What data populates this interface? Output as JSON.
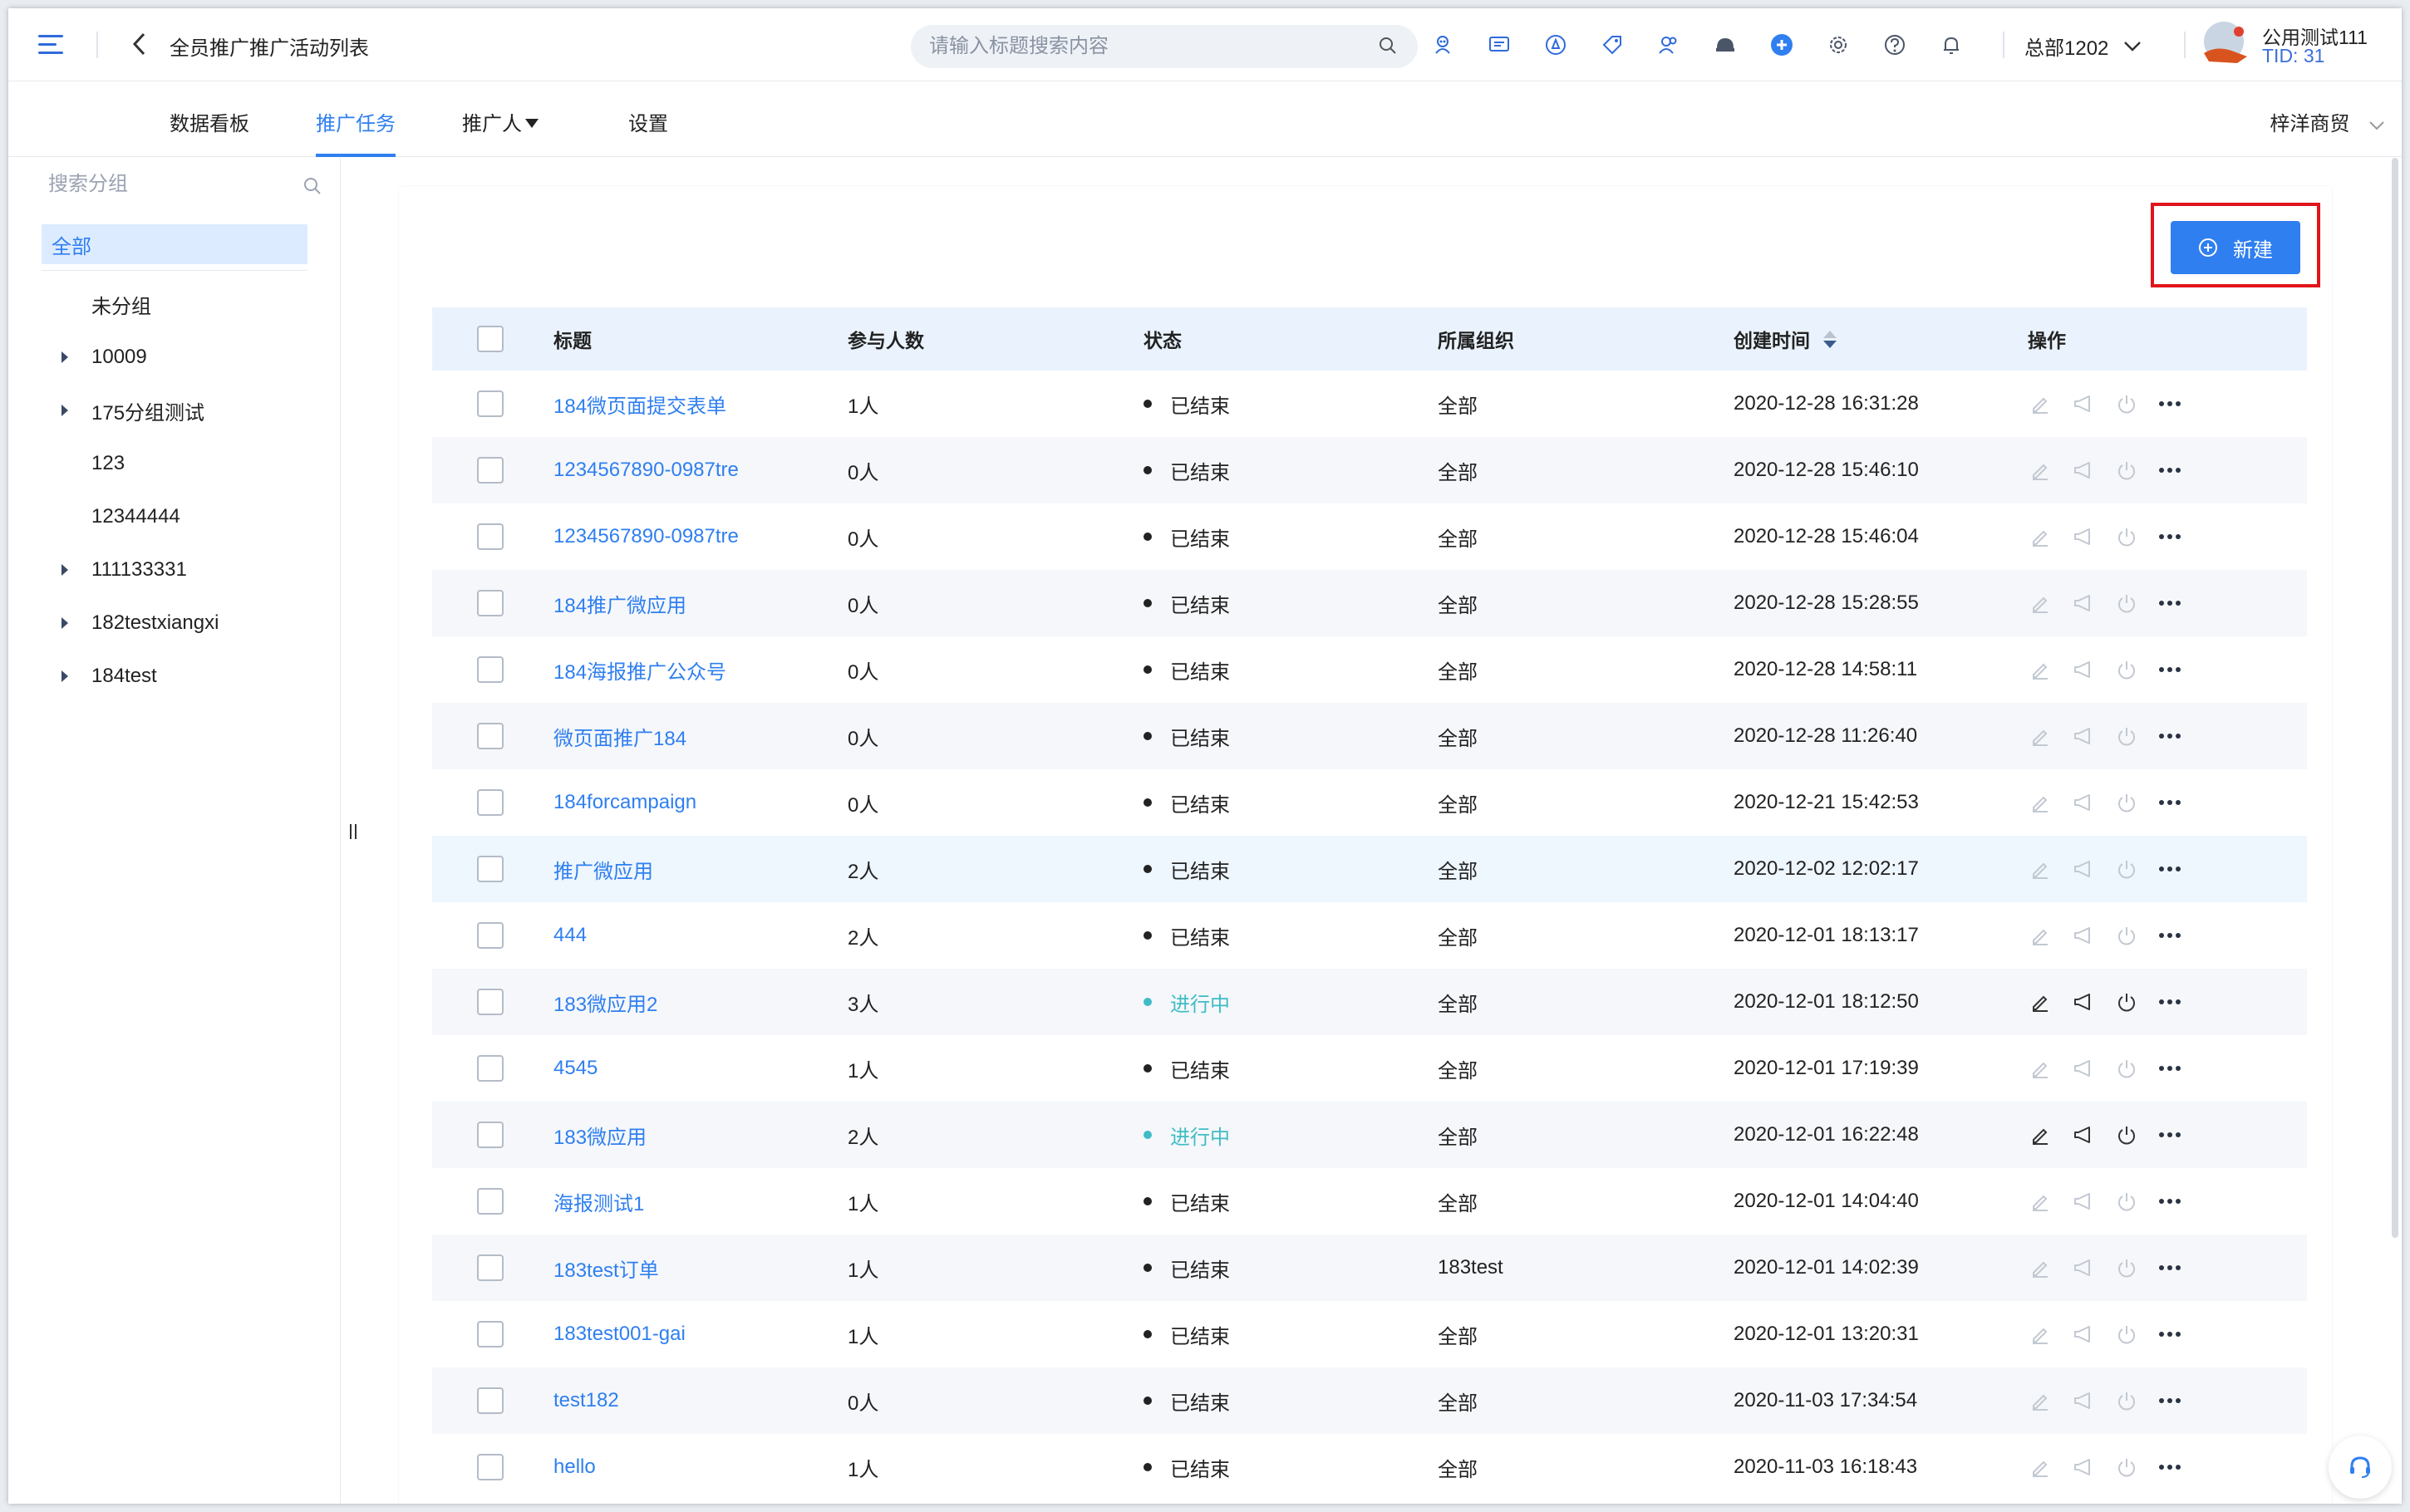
{
  "header": {
    "title": "全员推广推广活动列表",
    "search_placeholder": "请输入标题搜索内容",
    "org": "总部1202",
    "user_name": "公用测试111",
    "user_tid": "TID: 31"
  },
  "tabs": [
    {
      "label": "数据看板"
    },
    {
      "label": "推广任务"
    },
    {
      "label": "推广人"
    },
    {
      "label": "设置"
    }
  ],
  "tab_right": "梓洋商贸",
  "sidebar": {
    "search_placeholder": "搜索分组",
    "items": [
      {
        "label": "全部"
      },
      {
        "label": "未分组"
      },
      {
        "label": "10009"
      },
      {
        "label": "175分组测试"
      },
      {
        "label": "123"
      },
      {
        "label": "12344444"
      },
      {
        "label": "111133331"
      },
      {
        "label": "182testxiangxi"
      },
      {
        "label": "184test"
      }
    ]
  },
  "new_button": "新建",
  "table": {
    "columns": [
      "标题",
      "参与人数",
      "状态",
      "所属组织",
      "创建时间",
      "操作"
    ],
    "rows": [
      {
        "title": "184微页面提交表单",
        "count": "1人",
        "status": "已结束",
        "org": "全部",
        "time": "2020-12-28 16:31:28"
      },
      {
        "title": "1234567890-0987tre",
        "count": "0人",
        "status": "已结束",
        "org": "全部",
        "time": "2020-12-28 15:46:10"
      },
      {
        "title": "1234567890-0987tre",
        "count": "0人",
        "status": "已结束",
        "org": "全部",
        "time": "2020-12-28 15:46:04"
      },
      {
        "title": "184推广微应用",
        "count": "0人",
        "status": "已结束",
        "org": "全部",
        "time": "2020-12-28 15:28:55"
      },
      {
        "title": "184海报推广公众号",
        "count": "0人",
        "status": "已结束",
        "org": "全部",
        "time": "2020-12-28 14:58:11"
      },
      {
        "title": "微页面推广184",
        "count": "0人",
        "status": "已结束",
        "org": "全部",
        "time": "2020-12-28 11:26:40"
      },
      {
        "title": "184forcampaign",
        "count": "0人",
        "status": "已结束",
        "org": "全部",
        "time": "2020-12-21 15:42:53"
      },
      {
        "title": "推广微应用",
        "count": "2人",
        "status": "已结束",
        "org": "全部",
        "time": "2020-12-02 12:02:17"
      },
      {
        "title": "444",
        "count": "2人",
        "status": "已结束",
        "org": "全部",
        "time": "2020-12-01 18:13:17"
      },
      {
        "title": "183微应用2",
        "count": "3人",
        "status": "进行中",
        "org": "全部",
        "time": "2020-12-01 18:12:50"
      },
      {
        "title": "4545",
        "count": "1人",
        "status": "已结束",
        "org": "全部",
        "time": "2020-12-01 17:19:39"
      },
      {
        "title": "183微应用",
        "count": "2人",
        "status": "进行中",
        "org": "全部",
        "time": "2020-12-01 16:22:48"
      },
      {
        "title": "海报测试1",
        "count": "1人",
        "status": "已结束",
        "org": "全部",
        "time": "2020-12-01 14:04:40"
      },
      {
        "title": "183test订单",
        "count": "1人",
        "status": "已结束",
        "org": "183test",
        "time": "2020-12-01 14:02:39"
      },
      {
        "title": "183test001-gai",
        "count": "1人",
        "status": "已结束",
        "org": "全部",
        "time": "2020-12-01 13:20:31"
      },
      {
        "title": "test182",
        "count": "0人",
        "status": "已结束",
        "org": "全部",
        "time": "2020-11-03 17:34:54"
      },
      {
        "title": "hello",
        "count": "1人",
        "status": "已结束",
        "org": "全部",
        "time": "2020-11-03 16:18:43"
      }
    ]
  },
  "colors": {
    "accent": "#2f7ff0",
    "active_status": "#3fbcc5",
    "highlight_box": "#e0151b"
  }
}
